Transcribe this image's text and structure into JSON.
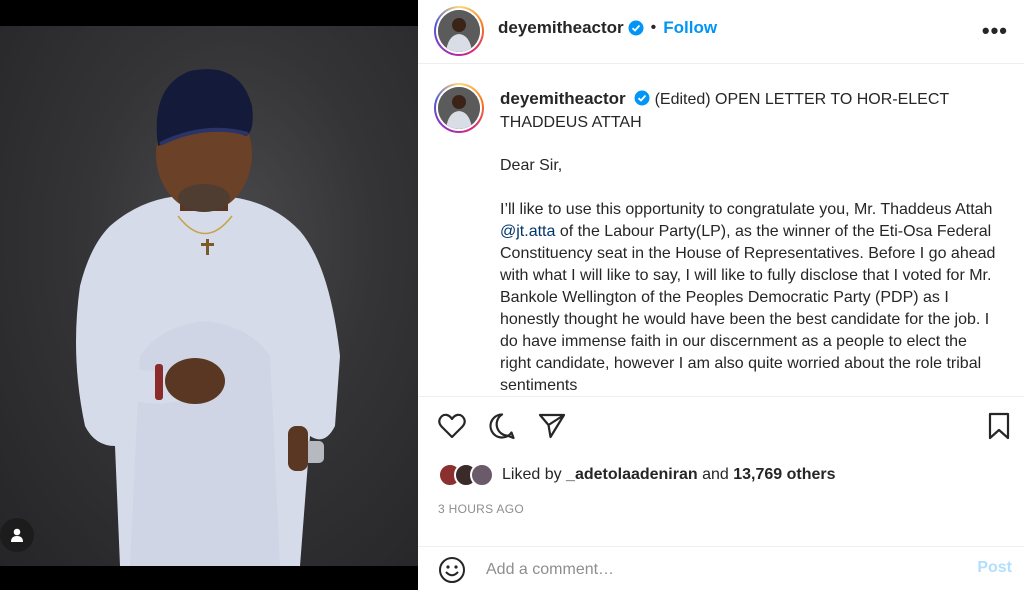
{
  "post": {
    "username": "deyemitheactor",
    "follow_label": "Follow",
    "dot": "•",
    "more_label": "•••",
    "caption_title": "(Edited) OPEN LETTER TO HOR-ELECT THADDEUS ATTAH",
    "greeting": "Dear Sir,",
    "body_before_mention": "I’ll like to use this opportunity to congratulate you, Mr. Thaddeus Attah ",
    "mention": "@jt.atta",
    "body_after_mention": " of the Labour Party(LP), as the winner of the Eti-Osa Federal Constituency seat in the House of Representatives. Before I go ahead with what I will like to say, I will like to fully disclose that I voted for Mr. Bankole Wellington of the Peoples Democratic Party (PDP) as I honestly thought he would have been the best candidate for the job. I do have immense faith in our discernment as a people to elect the right candidate, however I am also quite worried about the role tribal sentiments",
    "liked_by_prefix": "Liked by ",
    "liked_by_user": "_adetolaadeniran",
    "liked_and": " and ",
    "liked_others": "13,769 others",
    "time_ago": "3 HOURS AGO",
    "comment_placeholder": "Add a comment…",
    "post_label": "Post"
  },
  "icons": [
    "person-tag-icon",
    "verified-badge-icon",
    "heart-icon",
    "comment-icon",
    "share-icon",
    "bookmark-icon",
    "emoji-icon"
  ],
  "colors": {
    "accent": "#0095f6",
    "post_disabled": "#b2dffc",
    "text": "#262626",
    "muted": "#8e8e8e",
    "mention": "#00376b"
  }
}
